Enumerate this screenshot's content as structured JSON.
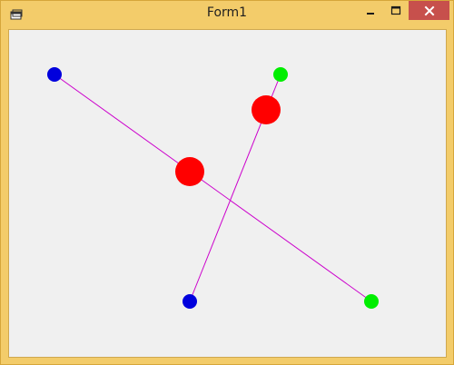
{
  "window": {
    "title": "Form1",
    "frame_color": "#f3cc6a",
    "client_color": "#f0f0f0"
  },
  "controls": {
    "minimize_icon": "minimize-icon",
    "maximize_icon": "maximize-icon",
    "close_icon": "close-icon",
    "close_color": "#c7504c"
  },
  "drawing": {
    "line_color": "#cc00cc",
    "start_color": "#0000dd",
    "end_color": "#00ee00",
    "midpoint_color": "#ff0000"
  }
}
